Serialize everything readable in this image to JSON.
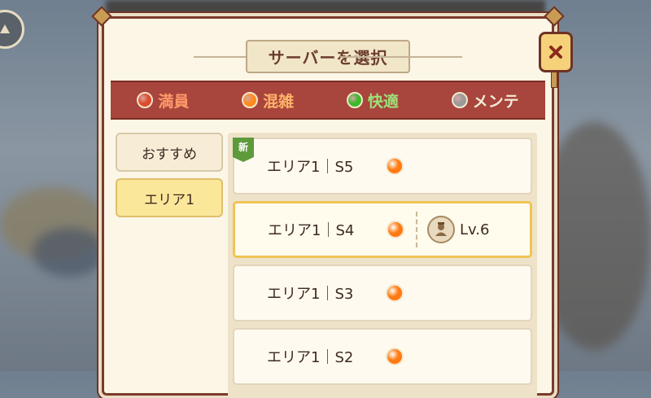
{
  "dialog": {
    "title": "サーバーを選択"
  },
  "legend": [
    {
      "label": "満員",
      "color": "#e04a2c",
      "text_color": "#ff9a6a"
    },
    {
      "label": "混雑",
      "color": "#ff8a1c",
      "text_color": "#ffb36a"
    },
    {
      "label": "快適",
      "color": "#3cba2a",
      "text_color": "#9fe07a"
    },
    {
      "label": "メンテ",
      "color": "#9a9a9a",
      "text_color": "#f4ead8"
    }
  ],
  "tabs": [
    {
      "label": "おすすめ",
      "active": false
    },
    {
      "label": "エリア1",
      "active": true
    }
  ],
  "servers": [
    {
      "name": "エリア1｜S5",
      "status_color": "#ff7a12",
      "new_badge": "新"
    },
    {
      "name": "エリア1｜S4",
      "status_color": "#ff7a12",
      "character_level": "Lv.6"
    },
    {
      "name": "エリア1｜S3",
      "status_color": "#ff7a12"
    },
    {
      "name": "エリア1｜S2",
      "status_color": "#ff7a12"
    }
  ]
}
